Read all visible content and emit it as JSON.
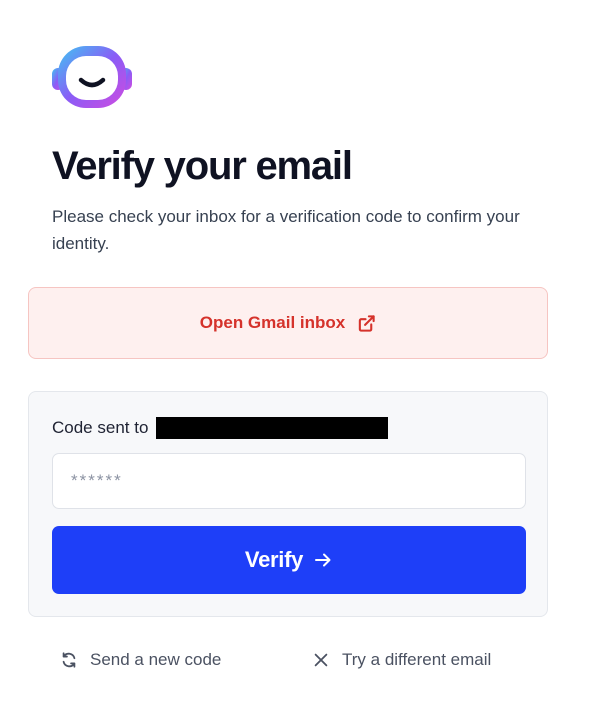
{
  "header": {
    "logo_icon": "smiling-robot-head-icon",
    "title": "Verify your email",
    "subtitle": "Please check your inbox for a verification code to confirm your identity."
  },
  "gmail": {
    "label": "Open Gmail inbox",
    "icon": "external-link-icon"
  },
  "code_card": {
    "sent_to_label": "Code sent to",
    "recipient_redacted": true,
    "input": {
      "placeholder": "******",
      "value": ""
    },
    "verify_button": {
      "label": "Verify",
      "icon": "arrow-right-icon"
    }
  },
  "footer": {
    "send_new_code": {
      "label": "Send a new code",
      "icon": "refresh-icon"
    },
    "try_different_email": {
      "label": "Try a different email",
      "icon": "close-icon"
    }
  },
  "colors": {
    "accent_blue": "#1e3ff8",
    "alert_red": "#d5322b",
    "alert_bg": "#fef0ef",
    "alert_border": "#f6c5c2",
    "card_bg": "#f7f8fa"
  }
}
